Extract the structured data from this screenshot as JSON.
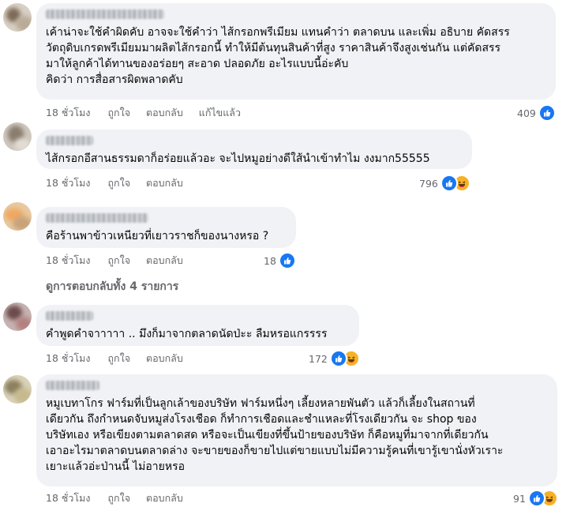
{
  "comments": [
    {
      "text": "เค้าน่าจะใช้คำผิดคับ อาจจะใช้คำว่า ไส้กรอกพรีเมียม แทนคำว่า ตลาดบน และเพิ่ม อธิบาย คัดสรร\nวัตถุดิบเกรดพรีเมียมมาผลิตไส้กรอกนี้ ทำให้มีต้นทุนสินค้าที่สูง ราคาสินค้าจึงสูงเช่นกัน แต่คัดสรร\nมาให้ลูกค้าได้ทานของอร่อยๆ สะอาด ปลอดภัย อะไรแบบนี้อ่ะคับ\nคิดว่า การสื่อสารผิดพลาดคับ",
      "time": "18 ชั่วโมง",
      "like": "ถูกใจ",
      "reply": "ตอบกลับ",
      "edited": "แก้ไขแล้ว",
      "reaction_count": "409",
      "reactions": [
        "like"
      ]
    },
    {
      "text": "ไส้กรอกอีสานธรรมดาก็อร่อยแล้วอะ จะไปหมูอย่างดีใส้นำเข้าทำไม งงมาก55555",
      "time": "18 ชั่วโมง",
      "like": "ถูกใจ",
      "reply": "ตอบกลับ",
      "reaction_count": "796",
      "reactions": [
        "like",
        "haha"
      ]
    },
    {
      "text": "คือร้านพาข้าวเหนียวที่เยาวราชก็ของนางหรอ ?",
      "time": "18 ชั่วโมง",
      "like": "ถูกใจ",
      "reply": "ตอบกลับ",
      "reaction_count": "18",
      "reactions": [
        "like"
      ]
    },
    {
      "text": "คำพูดคำจาาาาา .. มึงก็มาจากตลาดนัดป่ะะ ลืมหรอแกรรรร",
      "time": "18 ชั่วโมง",
      "like": "ถูกใจ",
      "reply": "ตอบกลับ",
      "reaction_count": "172",
      "reactions": [
        "like",
        "haha"
      ]
    },
    {
      "text": "หมูเบทาโกร ฟาร์มที่เป็นลูกเล้าของบริษัท ฟาร์มหนึ่งๆ เลี้ยงหลายพันตัว แล้วก็เลี้ยงในสถานที่\nเดียวกัน ถึงกำหนดจับหมูส่งโรงเชือด ก็ทำการเชือดและชำแหละที่โรงเดียวกัน จะ shop ของ\nบริษัทเอง หรือเขียงตามตลาดสด หรือจะเป็นเขียงที่ขึ้นป้ายของบริษัท ก็คือหมูที่มาจากที่เดียวกัน\nเอาอะไรมาตลาดบนตลาดล่าง จะขายของก็ขายไปแต่ขายแบบไม่มีความรู้คนที่เขารู้เขานั่งหัวเราะ\nเยาะแล้วอ่ะป่านนี้ ไม่อายหรอ",
      "time": "18 ชั่วโมง",
      "like": "ถูกใจ",
      "reply": "ตอบกลับ",
      "reaction_count": "91",
      "reactions": [
        "like",
        "haha"
      ]
    }
  ],
  "view_replies": "ดูการตอบกลับทั้ง 4 รายการ",
  "colors": {
    "like": "#1877f2",
    "haha": "#f7b125",
    "bubble": "#f0f2f5",
    "meta": "#65676b"
  },
  "icons": {
    "like": "thumbs-up-icon",
    "haha": "laughing-face-icon"
  }
}
